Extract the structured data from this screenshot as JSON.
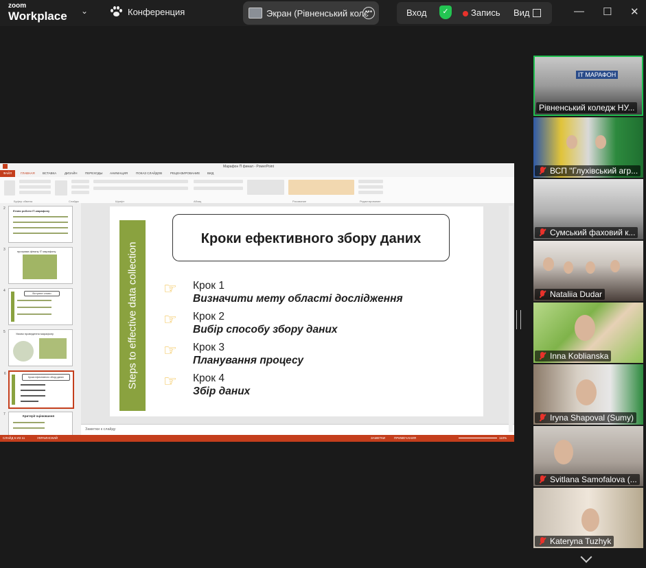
{
  "app": {
    "logo_top": "zoom",
    "logo_bottom": "Workplace",
    "meeting_label": "Конференция",
    "share_label": "Экран (Рівненський колє",
    "enter_label": "Вход",
    "record_label": "Запись",
    "view_label": "Вид"
  },
  "window_controls": {
    "minimize": "—",
    "maximize": "☐",
    "close": "✕"
  },
  "ppt": {
    "title": "Марафон П финал - PowerPoint",
    "tabs": [
      "ФАЙЛ",
      "ГЛАВНАЯ",
      "ВСТАВКА",
      "ДИЗАЙН",
      "ПЕРЕХОДЫ",
      "АНИМАЦИЯ",
      "ПОКАЗ СЛАЙДОВ",
      "РЕЦЕНЗИРОВАНИЕ",
      "ВИД"
    ],
    "ribbon_groups": [
      "Буфер обмена",
      "Слайды",
      "Шрифт",
      "Абзац",
      "Рисование",
      "Редактирование"
    ],
    "notes_placeholder": "Заметки к слайду",
    "status_left": "СЛАЙД 6 ИЗ 11",
    "status_lang": "УКРАИНСКИЙ",
    "status_notes": "ЗАМЕТКИ",
    "status_comments": "ПРИМЕЧАНИЯ",
    "zoom_level": "110%",
    "thumb_numbers": [
      "2",
      "3",
      "4",
      "5",
      "6",
      "7"
    ],
    "thumb_titles": [
      "Етапи роботи ІТ-марафону",
      "програма фіналу IT марафону",
      "Вступне слово",
      "Умови проведення марафону",
      "Кроки ефективного збору даних",
      "Критерії оцінювання"
    ]
  },
  "slide": {
    "vertical_text": "Steps to effective data collection",
    "title": "Кроки ефективного збору даних",
    "steps": [
      {
        "label": "Крок 1",
        "desc": "Визначити мету області дослідження"
      },
      {
        "label": "Крок 2",
        "desc": "Вибір способу збору даних"
      },
      {
        "label": "Крок 3",
        "desc": "Планування процесу"
      },
      {
        "label": "Крок 4",
        "desc": "Збір даних"
      }
    ]
  },
  "participants": [
    {
      "name": "Рівненський коледж НУ...",
      "muted": false,
      "active": true
    },
    {
      "name": "ВСП \"Глухівський агр...",
      "muted": true,
      "active": false
    },
    {
      "name": "Сумський фаховий к...",
      "muted": true,
      "active": false
    },
    {
      "name": "Nataliia Dudar",
      "muted": true,
      "active": false
    },
    {
      "name": "Inna Koblianska",
      "muted": true,
      "active": false
    },
    {
      "name": "Iryna Shapoval (Sumy)",
      "muted": true,
      "active": false
    },
    {
      "name": "Svitlana Samofalova (...",
      "muted": true,
      "active": false
    },
    {
      "name": "Kateryna Tuzhyk",
      "muted": true,
      "active": false
    }
  ],
  "colors": {
    "slide_accent": "#8aa23f",
    "ppt_brand": "#c43e1c",
    "active_speaker": "#1fbf4f",
    "record": "#e8322b"
  }
}
